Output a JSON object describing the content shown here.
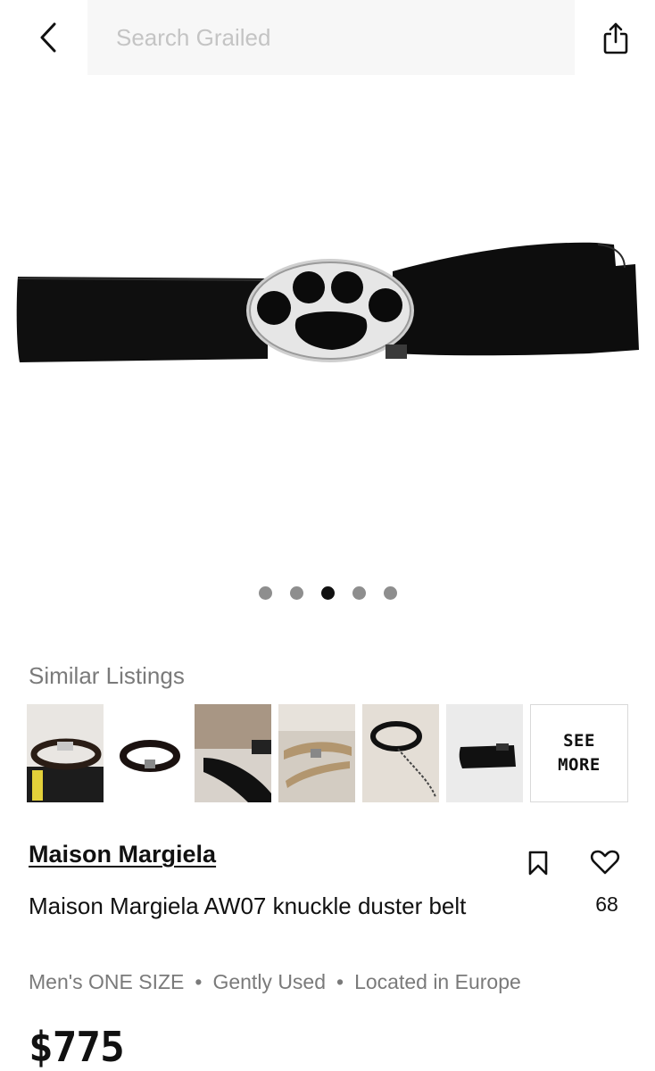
{
  "header": {
    "search_placeholder": "Search Grailed",
    "back_icon": "chevron-left-icon",
    "share_icon": "share-icon"
  },
  "gallery": {
    "image_count": 5,
    "active_index": 2
  },
  "similar": {
    "title": "Similar Listings",
    "see_more_line1": "SEE",
    "see_more_line2": "MORE"
  },
  "listing": {
    "designer": "Maison Margiela",
    "title": "Maison Margiela AW07 knuckle duster belt",
    "likes": "68",
    "size": "Men's ONE SIZE",
    "condition": "Gently Used",
    "location": "Located in Europe",
    "separator": "•",
    "price": "$775"
  }
}
